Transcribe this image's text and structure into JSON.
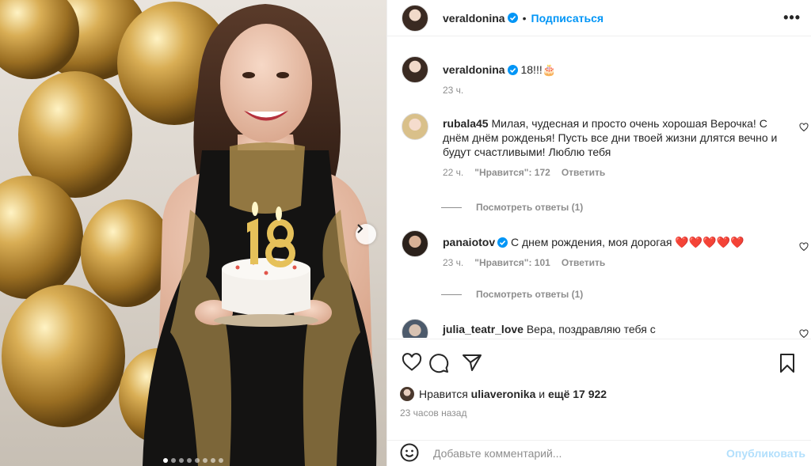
{
  "header": {
    "username": "veraldonina",
    "separator": "•",
    "follow_label": "Подписаться",
    "more_label": "•••"
  },
  "caption": {
    "username": "veraldonina",
    "text": "18!!!🎂",
    "time": "23 ч."
  },
  "comments": [
    {
      "username": "rubala45",
      "text": "Милая, чудесная и просто очень хорошая Верочка! С днём днём рожденья! Пусть все дни твоей жизни длятся вечно и будут счастливыми! Люблю тебя",
      "time": "22 ч.",
      "likes": "\"Нравится\": 172",
      "reply_label": "Ответить",
      "view_replies": "Посмотреть ответы (1)"
    },
    {
      "username": "panaiotov",
      "verified": true,
      "text": "С днем рождения, моя дорогая ❤️❤️❤️❤️❤️",
      "time": "23 ч.",
      "likes": "\"Нравится\": 101",
      "reply_label": "Ответить",
      "view_replies": "Посмотреть ответы (1)"
    },
    {
      "username": "julia_teatr_love",
      "text": "Вера, поздравляю тебя с"
    }
  ],
  "likes": {
    "prefix": "Нравится",
    "user": "uliaveronika",
    "joiner": "и",
    "others": "ещё 17 922"
  },
  "time_ago": "23 часов назад",
  "add_comment": {
    "placeholder": "Добавьте комментарий...",
    "publish_label": "Опубликовать"
  },
  "carousel": {
    "total": 8,
    "active": 0
  },
  "colors": {
    "accent": "#0095f6",
    "text": "#262626",
    "muted": "#8e8e8e",
    "heart_red": "#ed4956"
  },
  "icons": [
    "verified-icon",
    "heart-icon",
    "comment-icon",
    "share-icon",
    "bookmark-icon",
    "emoji-icon",
    "chevron-right-icon"
  ]
}
